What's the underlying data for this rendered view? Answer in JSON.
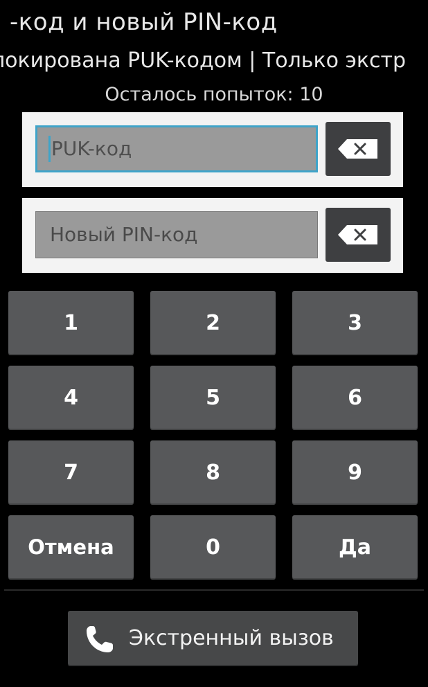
{
  "header": {
    "title": "-код и новый PIN-код",
    "status": "локирована PUK-кодом | Только экстр",
    "attempts": "Осталось попыток: 10"
  },
  "fields": {
    "puk": {
      "placeholder": "PUK-код",
      "value": "",
      "focused": true
    },
    "new_pin": {
      "placeholder": "Новый PIN-код",
      "value": "",
      "focused": false
    }
  },
  "keypad": {
    "keys": [
      "1",
      "2",
      "3",
      "4",
      "5",
      "6",
      "7",
      "8",
      "9",
      "Отмена",
      "0",
      "Да"
    ]
  },
  "emergency": {
    "label": "Экстренный вызов",
    "icon": "phone-icon"
  },
  "icons": {
    "backspace": "backspace-icon"
  },
  "colors": {
    "background": "#000000",
    "key": "#57585a",
    "focus_accent": "#3fa4c9",
    "card": "#f3f3f3",
    "field": "#9a9a9a"
  }
}
